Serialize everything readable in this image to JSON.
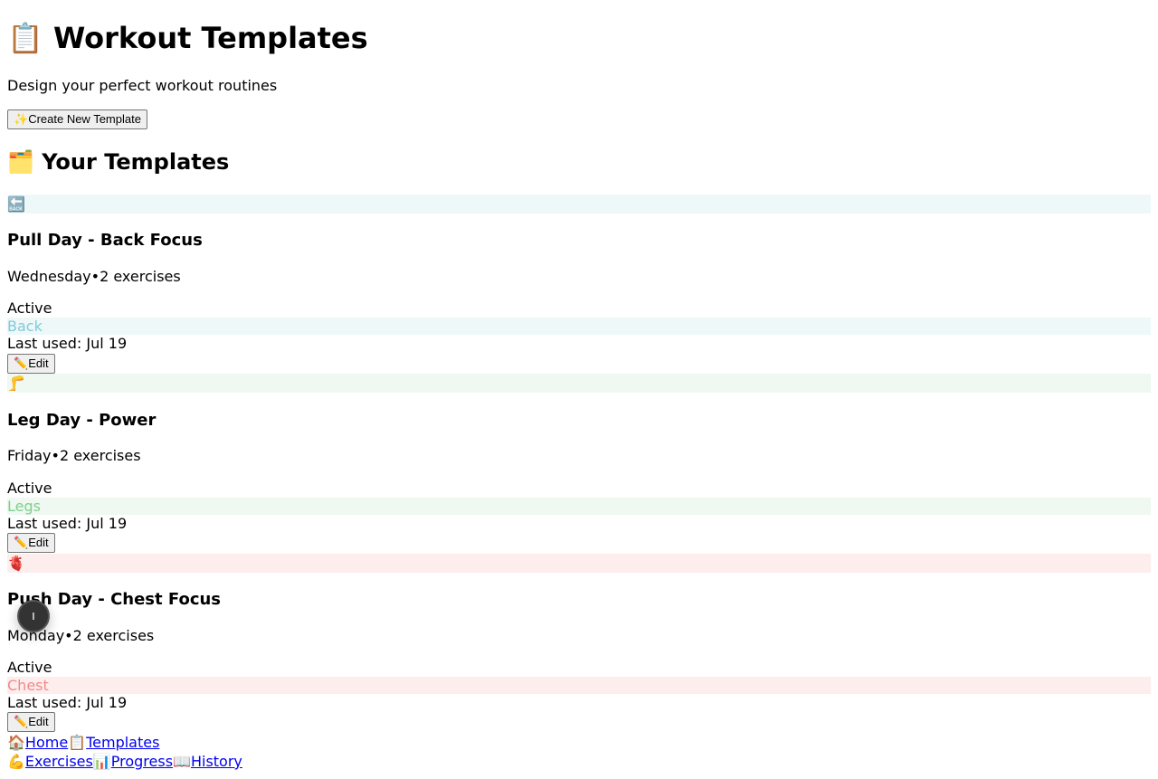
{
  "header": {
    "title_icon": "📋",
    "title": "Workout Templates",
    "subtitle": "Design your perfect workout routines",
    "create_icon": "✨",
    "create_label": "Create New Template"
  },
  "section": {
    "icon": "🗂️",
    "title": "Your Templates"
  },
  "templates": [
    {
      "icon": "🔙",
      "icon_name": "back-icon",
      "name": "Pull Day - Back Focus",
      "day": "Wednesday",
      "sep": "•",
      "exercises": "2 exercises",
      "status": "Active",
      "tag": "Back",
      "tag_color": "#7ecbd9",
      "band_color": "#eff8f9",
      "last_used": "Last used: Jul 19",
      "edit_icon": "✏️",
      "edit_label": "Edit"
    },
    {
      "icon": "🦵",
      "icon_name": "leg-icon",
      "name": "Leg Day - Power",
      "day": "Friday",
      "sep": "•",
      "exercises": "2 exercises",
      "status": "Active",
      "tag": "Legs",
      "tag_color": "#7fcf8e",
      "band_color": "#eff8f1",
      "last_used": "Last used: Jul 19",
      "edit_icon": "✏️",
      "edit_label": "Edit"
    },
    {
      "icon": "🫀",
      "icon_name": "heart-icon",
      "name": "Push Day - Chest Focus",
      "day": "Monday",
      "sep": "•",
      "exercises": "2 exercises",
      "status": "Active",
      "tag": "Chest",
      "tag_color": "#f08a8a",
      "band_color": "#fdeeed",
      "last_used": "Last used: Jul 19",
      "edit_icon": "✏️",
      "edit_label": "Edit"
    }
  ],
  "nav": {
    "home_icon": "🏠",
    "home": "Home",
    "templates_icon": "📋",
    "templates": "Templates",
    "exercises_icon": "💪",
    "exercises": "Exercises",
    "progress_icon": "📊",
    "progress": "Progress",
    "history_icon": "📖",
    "history": "History"
  },
  "fab": {
    "label": "ı"
  }
}
